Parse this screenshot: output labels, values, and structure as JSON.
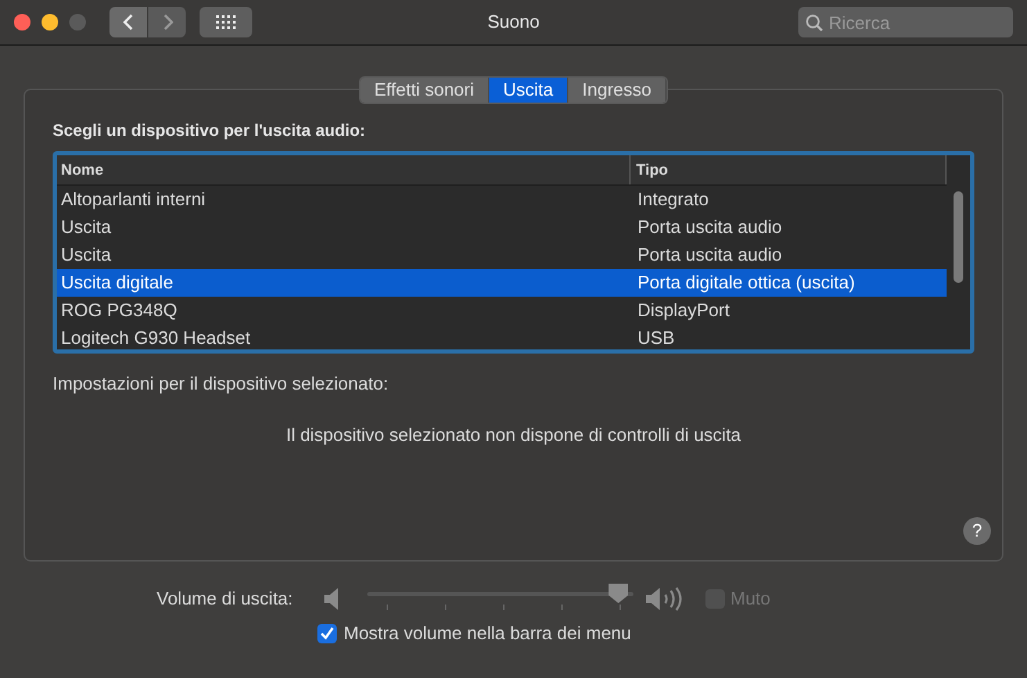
{
  "window": {
    "title": "Suono"
  },
  "search": {
    "placeholder": "Ricerca"
  },
  "tabs": [
    {
      "label": "Effetti sonori",
      "selected": false
    },
    {
      "label": "Uscita",
      "selected": true
    },
    {
      "label": "Ingresso",
      "selected": false
    }
  ],
  "device_heading": "Scegli un dispositivo per l'uscita audio:",
  "table": {
    "columns": [
      "Nome",
      "Tipo"
    ],
    "rows": [
      {
        "name": "Altoparlanti interni",
        "type": "Integrato",
        "selected": false
      },
      {
        "name": "Uscita",
        "type": "Porta uscita audio",
        "selected": false
      },
      {
        "name": "Uscita",
        "type": "Porta uscita audio",
        "selected": false
      },
      {
        "name": "Uscita digitale",
        "type": "Porta digitale ottica (uscita)",
        "selected": true
      },
      {
        "name": "ROG PG348Q",
        "type": "DisplayPort",
        "selected": false
      },
      {
        "name": "Logitech G930 Headset",
        "type": "USB",
        "selected": false
      }
    ]
  },
  "settings_label": "Impostazioni per il dispositivo selezionato:",
  "no_controls_message": "Il dispositivo selezionato non dispone di controlli di uscita",
  "help": "?",
  "volume": {
    "label": "Volume di uscita:",
    "level": 0.98,
    "disabled": true
  },
  "mute": {
    "label": "Muto",
    "checked": false,
    "disabled": true
  },
  "show_in_menu_bar": {
    "label": "Mostra volume nella barra dei menu",
    "checked": true
  }
}
